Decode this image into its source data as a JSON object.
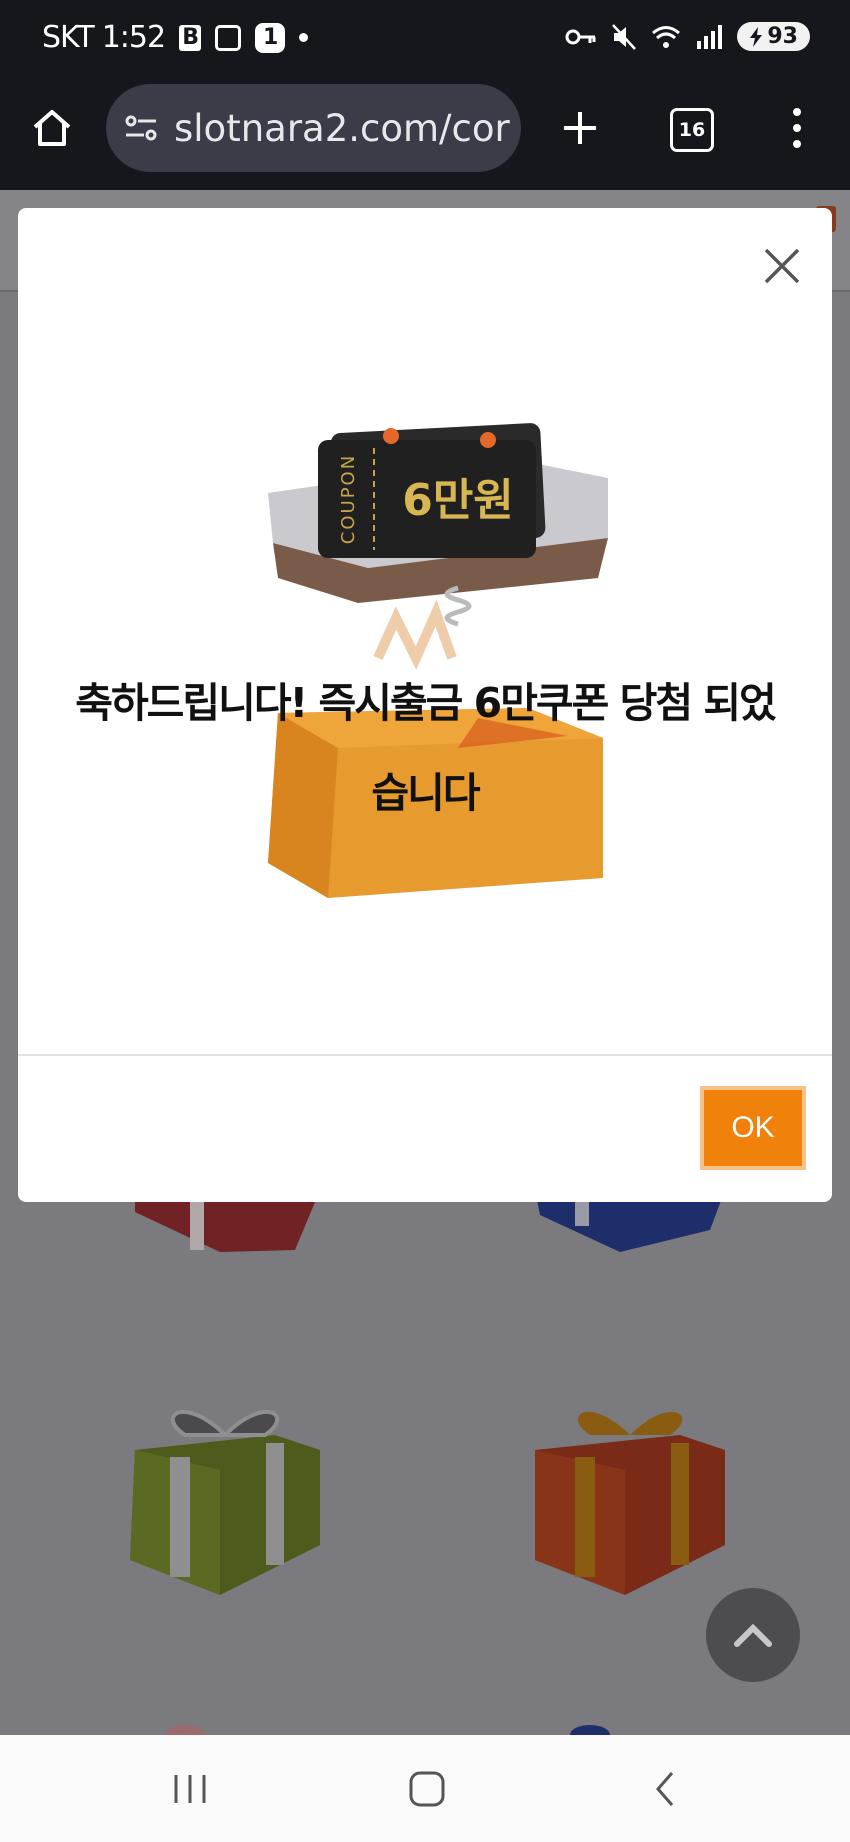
{
  "status_bar": {
    "carrier": "SKT",
    "time": "1:52",
    "notification_count": "1",
    "battery_level": "93"
  },
  "browser": {
    "url": "slotnara2.com/cor",
    "tab_count": "16"
  },
  "modal": {
    "message_line1": "축하드립니다! 즉시출금 6만쿠폰 당첨 되었",
    "message_line2": "습니다",
    "ok_label": "OK",
    "illustration": {
      "ticket_label": "COUPON",
      "ticket_amount": "6만원"
    }
  },
  "colors": {
    "accent_orange": "#f0810a",
    "status_bar_bg": "#15171c",
    "overlay_gray": "#7b7b7f"
  }
}
